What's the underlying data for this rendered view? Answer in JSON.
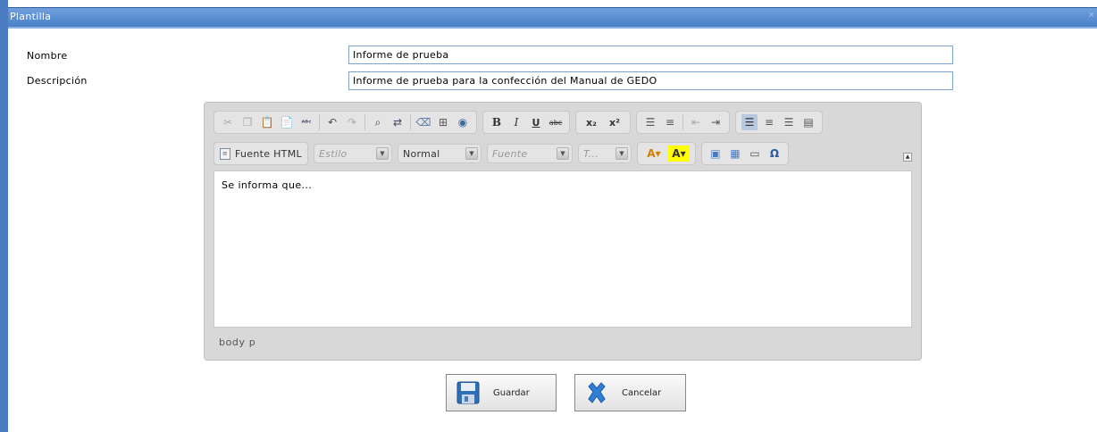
{
  "window": {
    "title": "Plantilla"
  },
  "form": {
    "nombre_label": "Nombre",
    "nombre_value": "Informe de prueba",
    "descripcion_label": "Descripción",
    "descripcion_value": "Informe de prueba para la confección del Manual de GEDO"
  },
  "editor": {
    "source_button": "Fuente HTML",
    "style_combo": "Estilo",
    "format_combo": "Normal",
    "font_combo": "Fuente",
    "size_combo": "T...",
    "content": "Se informa que...",
    "path": "body  p",
    "icons": {
      "cut": "cut-icon",
      "copy": "copy-icon",
      "paste": "paste-icon",
      "paste_text": "paste-text-icon",
      "spellcheck": "spellcheck-icon",
      "undo": "undo-icon",
      "redo": "redo-icon",
      "find": "find-icon",
      "replace": "replace-icon",
      "remove_format": "remove-format-icon",
      "select_all": "select-all-icon",
      "web_check": "web-check-icon"
    },
    "format_labels": {
      "bold": "B",
      "italic": "I",
      "underline": "U",
      "strike": "abc",
      "sub": "x₂",
      "sup": "x²"
    }
  },
  "actions": {
    "save": "Guardar",
    "cancel": "Cancelar"
  },
  "colors": {
    "titlebar": "#4b80c9",
    "accent": "#4a7bc0"
  }
}
